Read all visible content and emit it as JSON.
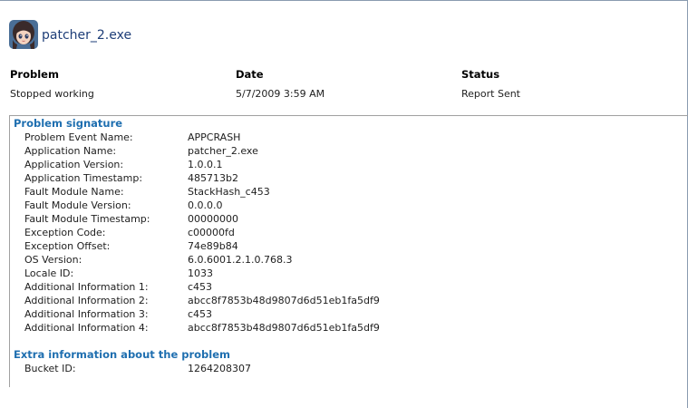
{
  "app": {
    "icon": "anime-avatar-icon",
    "title": "patcher_2.exe"
  },
  "summary": {
    "problem": {
      "header": "Problem",
      "value": "Stopped working"
    },
    "date": {
      "header": "Date",
      "value": "5/7/2009 3:59 AM"
    },
    "status": {
      "header": "Status",
      "value": "Report Sent"
    }
  },
  "signature": {
    "title": "Problem signature",
    "rows": [
      {
        "label": "Problem Event Name:",
        "value": "APPCRASH"
      },
      {
        "label": "Application Name:",
        "value": "patcher_2.exe"
      },
      {
        "label": "Application Version:",
        "value": "1.0.0.1"
      },
      {
        "label": "Application Timestamp:",
        "value": "485713b2"
      },
      {
        "label": "Fault Module Name:",
        "value": "StackHash_c453"
      },
      {
        "label": "Fault Module Version:",
        "value": "0.0.0.0"
      },
      {
        "label": "Fault Module Timestamp:",
        "value": "00000000"
      },
      {
        "label": "Exception Code:",
        "value": "c00000fd"
      },
      {
        "label": "Exception Offset:",
        "value": "74e89b84"
      },
      {
        "label": "OS Version:",
        "value": "6.0.6001.2.1.0.768.3"
      },
      {
        "label": "Locale ID:",
        "value": "1033"
      },
      {
        "label": "Additional Information 1:",
        "value": "c453"
      },
      {
        "label": "Additional Information 2:",
        "value": "abcc8f7853b48d9807d6d51eb1fa5df9"
      },
      {
        "label": "Additional Information 3:",
        "value": "c453"
      },
      {
        "label": "Additional Information 4:",
        "value": "abcc8f7853b48d9807d6d51eb1fa5df9"
      }
    ]
  },
  "extra": {
    "title": "Extra information about the problem",
    "rows": [
      {
        "label": "Bucket ID:",
        "value": "1264208307"
      }
    ]
  }
}
